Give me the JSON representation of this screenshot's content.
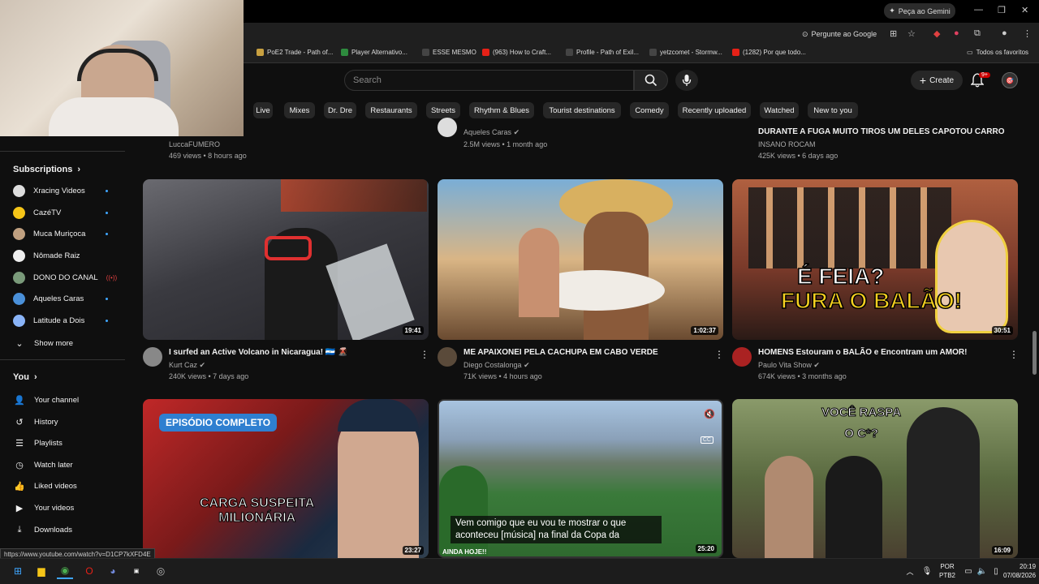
{
  "browser": {
    "gemini_label": "Peça ao Gemini",
    "ask_google_label": "Pergunte ao Google",
    "bookmarks": [
      {
        "label": "PoE2 Trade - Path of...",
        "color": "#c8a040"
      },
      {
        "label": "Player Alternativo...",
        "color": "#2e8b3e"
      },
      {
        "label": "ESSE MESMO",
        "color": "#444444"
      },
      {
        "label": "(963) How to Craft...",
        "color": "#e62117"
      },
      {
        "label": "Profile - Path of Exil...",
        "color": "#444444"
      },
      {
        "label": "yetzcomet - Stormw...",
        "color": "#444444"
      },
      {
        "label": "(1282) Por que todo...",
        "color": "#e62117"
      }
    ],
    "all_bookmarks_label": "Todos os favoritos",
    "status_url": "https://www.youtube.com/watch?v=D1CP7kXFD4E"
  },
  "header": {
    "search_placeholder": "Search",
    "create_label": "Create",
    "notif_count": "9+",
    "avatar_text": "🎯"
  },
  "chips": [
    "Live",
    "Mixes",
    "Dr. Dre",
    "Restaurants",
    "Streets",
    "Rhythm & Blues",
    "Tourist destinations",
    "Comedy",
    "Recently uploaded",
    "Watched",
    "New to you"
  ],
  "sidebar": {
    "subscriptions_label": "Subscriptions",
    "subscriptions": [
      {
        "label": "Xracing Videos",
        "color": "#dddddd"
      },
      {
        "label": "CazéTV",
        "color": "#f5c518"
      },
      {
        "label": "Muca Muriçoca",
        "color": "#c0a080"
      },
      {
        "label": "Nômade Raiz",
        "color": "#eeeeee"
      },
      {
        "label": "DONO DO CANAL",
        "color": "#7a9a7a"
      },
      {
        "label": "Aqueles Caras",
        "color": "#4a90d9"
      },
      {
        "label": "Latitude a Dois",
        "color": "#8ab4f8"
      }
    ],
    "show_more_label": "Show more",
    "you_label": "You",
    "you_items": [
      {
        "label": "Your channel",
        "icon": "person-box-icon",
        "glyph": "👤"
      },
      {
        "label": "History",
        "icon": "history-icon",
        "glyph": "↺"
      },
      {
        "label": "Playlists",
        "icon": "playlists-icon",
        "glyph": "☰"
      },
      {
        "label": "Watch later",
        "icon": "clock-icon",
        "glyph": "◷"
      },
      {
        "label": "Liked videos",
        "icon": "thumbs-up-icon",
        "glyph": "👍"
      },
      {
        "label": "Your videos",
        "icon": "play-box-icon",
        "glyph": "▶"
      },
      {
        "label": "Downloads",
        "icon": "download-icon",
        "glyph": "⤓"
      }
    ]
  },
  "top_row": [
    {
      "channel": "LuccaFUMERO",
      "meta": "469 views • 8 hours ago",
      "title": ""
    },
    {
      "channel": "Aqueles Caras",
      "meta": "2.5M views • 1 month ago",
      "title": ""
    },
    {
      "channel": "INSANO ROCAM",
      "meta": "425K views • 6 days ago",
      "title": "DURANTE A FUGA MUITO TIROS UM DELES CAPOTOU CARRO"
    }
  ],
  "videos_row2": [
    {
      "title": "I surfed an Active Volcano in Nicaragua! 🇳🇮 🌋",
      "channel": "Kurt Caz",
      "meta": "240K views • 7 days ago",
      "duration": "19:41",
      "thumb_colors": [
        "#3a3a40",
        "#8a8e96",
        "#2a2a2e"
      ],
      "avatar_color": "#888888"
    },
    {
      "title": "ME APAIXONEI PELA CACHUPA EM CABO VERDE",
      "channel": "Diego Costalonga",
      "meta": "71K views • 4 hours ago",
      "duration": "1:02:37",
      "thumb_colors": [
        "#7aaed6",
        "#c98d5a",
        "#3a2a20"
      ],
      "avatar_color": "#5a4a3a"
    },
    {
      "title": "HOMENS Estouram o BALÃO e Encontram um AMOR!",
      "channel": "Paulo Vita Show",
      "meta": "674K views • 3 months ago",
      "duration": "30:51",
      "thumb_colors": [
        "#b05040",
        "#222222",
        "#d0a070"
      ],
      "avatar_color": "#aa2222",
      "overlay_line1": "É FEIA?",
      "overlay_line2": "FURA O BALÃO!"
    }
  ],
  "videos_row3": [
    {
      "duration": "23:27",
      "badge": "EPISÓDIO COMPLETO",
      "overlay_line1": "CARGA SUSPEITA",
      "overlay_line2": "MILIONÁRIA",
      "thumb_colors": [
        "#b02020",
        "#1a2a40",
        "#304050"
      ]
    },
    {
      "duration": "25:20",
      "caption": "Vem comigo que eu vou te mostrar o que aconteceu [música] na final da Copa da",
      "label": "AINDA HOJE!!",
      "thumb_colors": [
        "#9ab8d8",
        "#3a7a3a",
        "#6a6a6a"
      ]
    },
    {
      "duration": "16:09",
      "overlay_line1": "VOCÊ RASPA",
      "overlay_line2": "O C*?",
      "thumb_colors": [
        "#7a8a5a",
        "#3a3a30",
        "#a09070"
      ]
    }
  ],
  "taskbar": {
    "lang_top": "POR",
    "lang_bottom": "PTB2",
    "time": "20:19",
    "date": "07/08/2026"
  }
}
